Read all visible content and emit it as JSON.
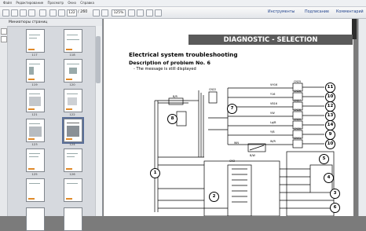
{
  "menubar": {
    "items": [
      "Файл",
      "Редактирование",
      "Просмотр",
      "Окно",
      "Справка"
    ]
  },
  "toolbar": {
    "page_current": "122",
    "page_total": "/ 260",
    "zoom": "125%",
    "tools": "Инструменты",
    "sign": "Подписание",
    "comment": "Комментарий"
  },
  "sidepanel": {
    "title": "Миниатюры страниц",
    "thumbs": [
      "117",
      "118",
      "119",
      "120",
      "121",
      "122",
      "123",
      "124",
      "125",
      "126"
    ]
  },
  "document": {
    "banner": "DIAGNOSTIC - SELECTION",
    "heading": "Electrical system troubleshooting",
    "subheading": "Description of problem No. 6",
    "bullet": "- The message is still displayed"
  },
  "diagram": {
    "callouts": [
      "11",
      "10",
      "12",
      "13",
      "14",
      "9",
      "10",
      "7",
      "8",
      "1",
      "2",
      "5",
      "4",
      "3",
      "6"
    ],
    "connector_labels": [
      "CN25",
      "CN26",
      "CN27",
      "CN28",
      "CN29",
      "CN30",
      "CN41",
      "CN31",
      "CN22",
      "CN3"
    ],
    "wire_labels": [
      "VH16",
      "Y16",
      "VB16",
      "VW",
      "Lg/B",
      "Y/B",
      "W/R",
      "B/R",
      "WN",
      "B/W"
    ]
  }
}
